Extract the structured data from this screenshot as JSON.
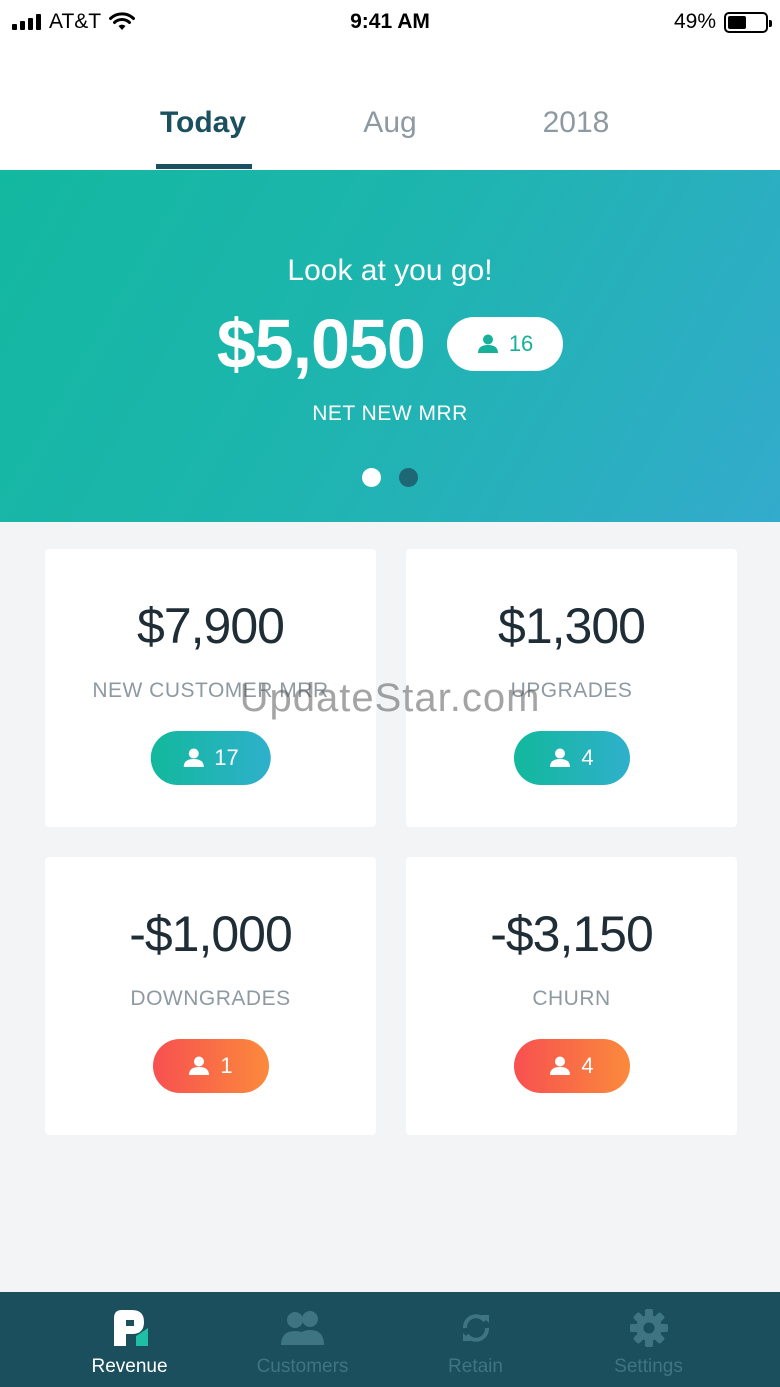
{
  "status_bar": {
    "carrier": "AT&T",
    "time": "9:41 AM",
    "battery": "49%",
    "battery_level": 0.49
  },
  "tabs": [
    {
      "label": "Today",
      "active": true
    },
    {
      "label": "Aug",
      "active": false
    },
    {
      "label": "2018",
      "active": false
    }
  ],
  "hero": {
    "title": "Look at you go!",
    "amount": "$5,050",
    "customers": "16",
    "label": "NET NEW MRR",
    "page_count": 2,
    "active_page": 0
  },
  "cards": [
    {
      "amount": "$7,900",
      "label": "NEW CUSTOMER MRR",
      "count": "17",
      "tone": "positive"
    },
    {
      "amount": "$1,300",
      "label": "UPGRADES",
      "count": "4",
      "tone": "positive"
    },
    {
      "amount": "-$1,000",
      "label": "DOWNGRADES",
      "count": "1",
      "tone": "negative"
    },
    {
      "amount": "-$3,150",
      "label": "CHURN",
      "count": "4",
      "tone": "negative"
    }
  ],
  "watermark": "UpdateStar.com",
  "nav": [
    {
      "label": "Revenue",
      "icon": "revenue-logo-icon",
      "active": true
    },
    {
      "label": "Customers",
      "icon": "customers-icon",
      "active": false
    },
    {
      "label": "Retain",
      "icon": "refresh-icon",
      "active": false
    },
    {
      "label": "Settings",
      "icon": "gear-icon",
      "active": false
    }
  ],
  "colors": {
    "primary_dark": "#1b4f5d",
    "positive_start": "#12b89c",
    "positive_end": "#2fb0cc",
    "negative_start": "#f75050",
    "negative_end": "#fb8a3c"
  }
}
